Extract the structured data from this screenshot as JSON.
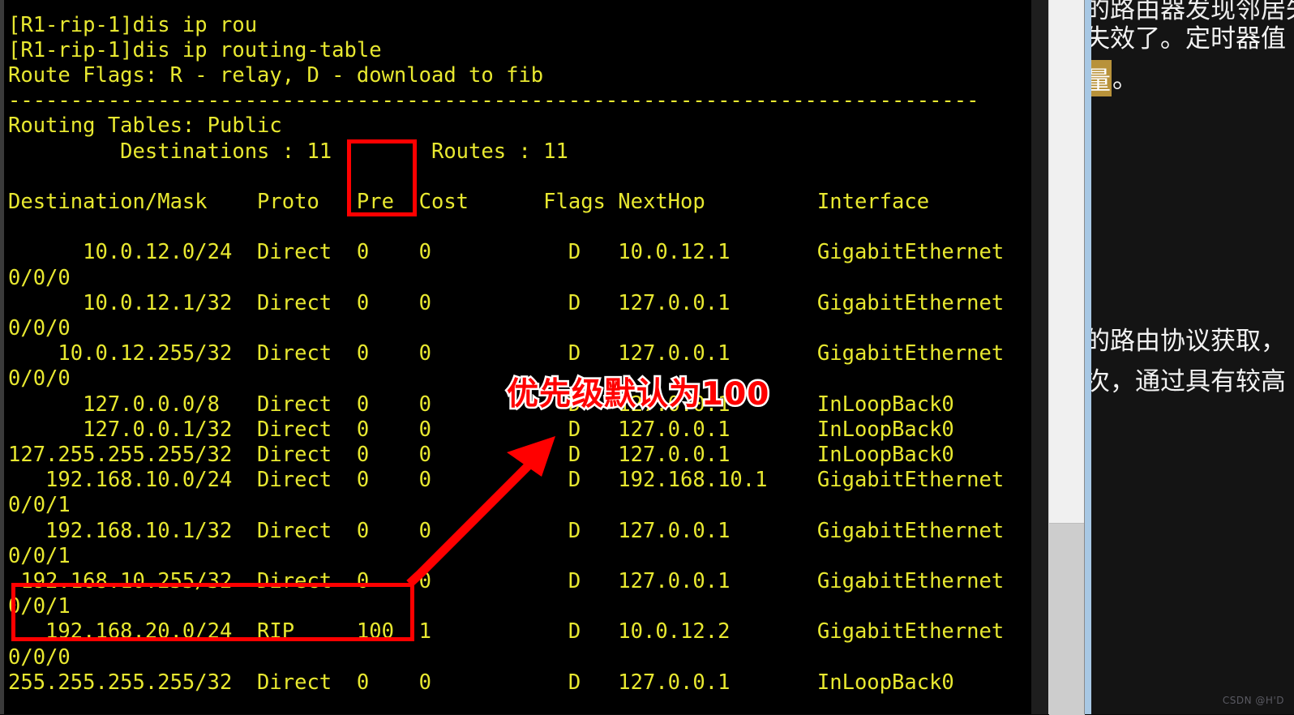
{
  "terminal": {
    "lines": [
      "[R1-rip-1]dis ip rou",
      "[R1-rip-1]dis ip routing-table",
      "Route Flags: R - relay, D - download to fib",
      "------------------------------------------------------------------------------",
      "Routing Tables: Public",
      "         Destinations : 11        Routes : 11",
      "",
      "Destination/Mask    Proto   Pre  Cost      Flags NextHop         Interface",
      "",
      "      10.0.12.0/24  Direct  0    0           D   10.0.12.1       GigabitEthernet",
      "0/0/0",
      "      10.0.12.1/32  Direct  0    0           D   127.0.0.1       GigabitEthernet",
      "0/0/0",
      "    10.0.12.255/32  Direct  0    0           D   127.0.0.1       GigabitEthernet",
      "0/0/0",
      "      127.0.0.0/8   Direct  0    0           D   127.0.0.1       InLoopBack0",
      "      127.0.0.1/32  Direct  0    0           D   127.0.0.1       InLoopBack0",
      "127.255.255.255/32  Direct  0    0           D   127.0.0.1       InLoopBack0",
      "   192.168.10.0/24  Direct  0    0           D   192.168.10.1    GigabitEthernet",
      "0/0/1",
      "   192.168.10.1/32  Direct  0    0           D   127.0.0.1       GigabitEthernet",
      "0/0/1",
      " 192.168.10.255/32  Direct  0    0           D   127.0.0.1       GigabitEthernet",
      "0/0/1",
      "   192.168.20.0/24  RIP     100  1           D   10.0.12.2       GigabitEthernet",
      "0/0/0",
      "255.255.255.255/32  Direct  0    0           D   127.0.0.1       InLoopBack0"
    ],
    "prompt": "[R1-rip-1]",
    "command": "dis ip routing-table",
    "route_flags": "Route Flags: R - relay, D - download to fib",
    "table_name": "Routing Tables: Public",
    "destinations_label": "Destinations",
    "destinations_count": "11",
    "routes_label": "Routes",
    "routes_count": "11",
    "columns": [
      "Destination/Mask",
      "Proto",
      "Pre",
      "Cost",
      "Flags",
      "NextHop",
      "Interface"
    ],
    "rows": [
      {
        "dest": "10.0.12.0/24",
        "proto": "Direct",
        "pre": "0",
        "cost": "0",
        "flags": "D",
        "nexthop": "10.0.12.1",
        "interface": "GigabitEthernet0/0/0"
      },
      {
        "dest": "10.0.12.1/32",
        "proto": "Direct",
        "pre": "0",
        "cost": "0",
        "flags": "D",
        "nexthop": "127.0.0.1",
        "interface": "GigabitEthernet0/0/0"
      },
      {
        "dest": "10.0.12.255/32",
        "proto": "Direct",
        "pre": "0",
        "cost": "0",
        "flags": "D",
        "nexthop": "127.0.0.1",
        "interface": "GigabitEthernet0/0/0"
      },
      {
        "dest": "127.0.0.0/8",
        "proto": "Direct",
        "pre": "0",
        "cost": "0",
        "flags": "D",
        "nexthop": "127.0.0.1",
        "interface": "InLoopBack0"
      },
      {
        "dest": "127.0.0.1/32",
        "proto": "Direct",
        "pre": "0",
        "cost": "0",
        "flags": "D",
        "nexthop": "127.0.0.1",
        "interface": "InLoopBack0"
      },
      {
        "dest": "127.255.255.255/32",
        "proto": "Direct",
        "pre": "0",
        "cost": "0",
        "flags": "D",
        "nexthop": "127.0.0.1",
        "interface": "InLoopBack0"
      },
      {
        "dest": "192.168.10.0/24",
        "proto": "Direct",
        "pre": "0",
        "cost": "0",
        "flags": "D",
        "nexthop": "192.168.10.1",
        "interface": "GigabitEthernet0/0/1"
      },
      {
        "dest": "192.168.10.1/32",
        "proto": "Direct",
        "pre": "0",
        "cost": "0",
        "flags": "D",
        "nexthop": "127.0.0.1",
        "interface": "GigabitEthernet0/0/1"
      },
      {
        "dest": "192.168.10.255/32",
        "proto": "Direct",
        "pre": "0",
        "cost": "0",
        "flags": "D",
        "nexthop": "127.0.0.1",
        "interface": "GigabitEthernet0/0/1"
      },
      {
        "dest": "192.168.20.0/24",
        "proto": "RIP",
        "pre": "100",
        "cost": "1",
        "flags": "D",
        "nexthop": "10.0.12.2",
        "interface": "GigabitEthernet0/0/0"
      },
      {
        "dest": "255.255.255.255/32",
        "proto": "Direct",
        "pre": "0",
        "cost": "0",
        "flags": "D",
        "nexthop": "127.0.0.1",
        "interface": "InLoopBack0"
      }
    ]
  },
  "annotations": {
    "label_text": "优先级默认为100",
    "label_color": "#ff0000",
    "label_outline": "#ffffff",
    "box_color": "#ff0000",
    "arrow_color": "#ff0000",
    "pre_box_target": "Pre",
    "rip_box_target": "192.168.20.0/24 RIP 100 1"
  },
  "note_panel": {
    "line0": "的路由器发现邻居失效",
    "line1": "失效了。定时器值",
    "line2_highlight": "量",
    "line2_rest": "。",
    "line3": "的路由协议获取，",
    "line4": "次，通过具有较高",
    "background": "#141414",
    "text_color": "#f2f2f2",
    "highlight_color": "#b8923a"
  },
  "watermark": {
    "text": "CSDN @H'D"
  },
  "scrollbar": {
    "track_color": "#f0f0f0",
    "thumb_color": "#cdcdcd"
  }
}
